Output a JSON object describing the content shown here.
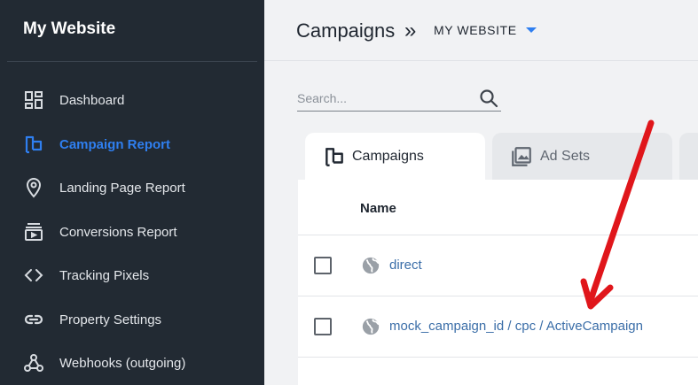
{
  "sidebar": {
    "brand": "My Website",
    "items": [
      {
        "label": "Dashboard",
        "icon": "dashboard-icon",
        "active": false
      },
      {
        "label": "Campaign Report",
        "icon": "flag-icon",
        "active": true
      },
      {
        "label": "Landing Page Report",
        "icon": "location-pin-icon",
        "active": false
      },
      {
        "label": "Conversions Report",
        "icon": "conversions-icon",
        "active": false
      },
      {
        "label": "Tracking Pixels",
        "icon": "code-icon",
        "active": false
      },
      {
        "label": "Property Settings",
        "icon": "link-icon",
        "active": false
      },
      {
        "label": "Webhooks (outgoing)",
        "icon": "webhook-icon",
        "active": false
      }
    ]
  },
  "header": {
    "title": "Campaigns",
    "separator": "»",
    "site_selector": "MY WEBSITE"
  },
  "search": {
    "placeholder": "Search..."
  },
  "tabs": [
    {
      "label": "Campaigns",
      "icon": "flag-icon",
      "active": true
    },
    {
      "label": "Ad Sets",
      "icon": "image-icon",
      "active": false
    }
  ],
  "table": {
    "columns": [
      "Name"
    ],
    "rows": [
      {
        "name": "direct"
      },
      {
        "name": "mock_campaign_id / cpc / ActiveCampaign"
      }
    ]
  },
  "colors": {
    "sidebar_bg": "#222a33",
    "accent": "#2f7ff0",
    "link": "#3b6ea8",
    "annotation_arrow": "#e0161b"
  }
}
